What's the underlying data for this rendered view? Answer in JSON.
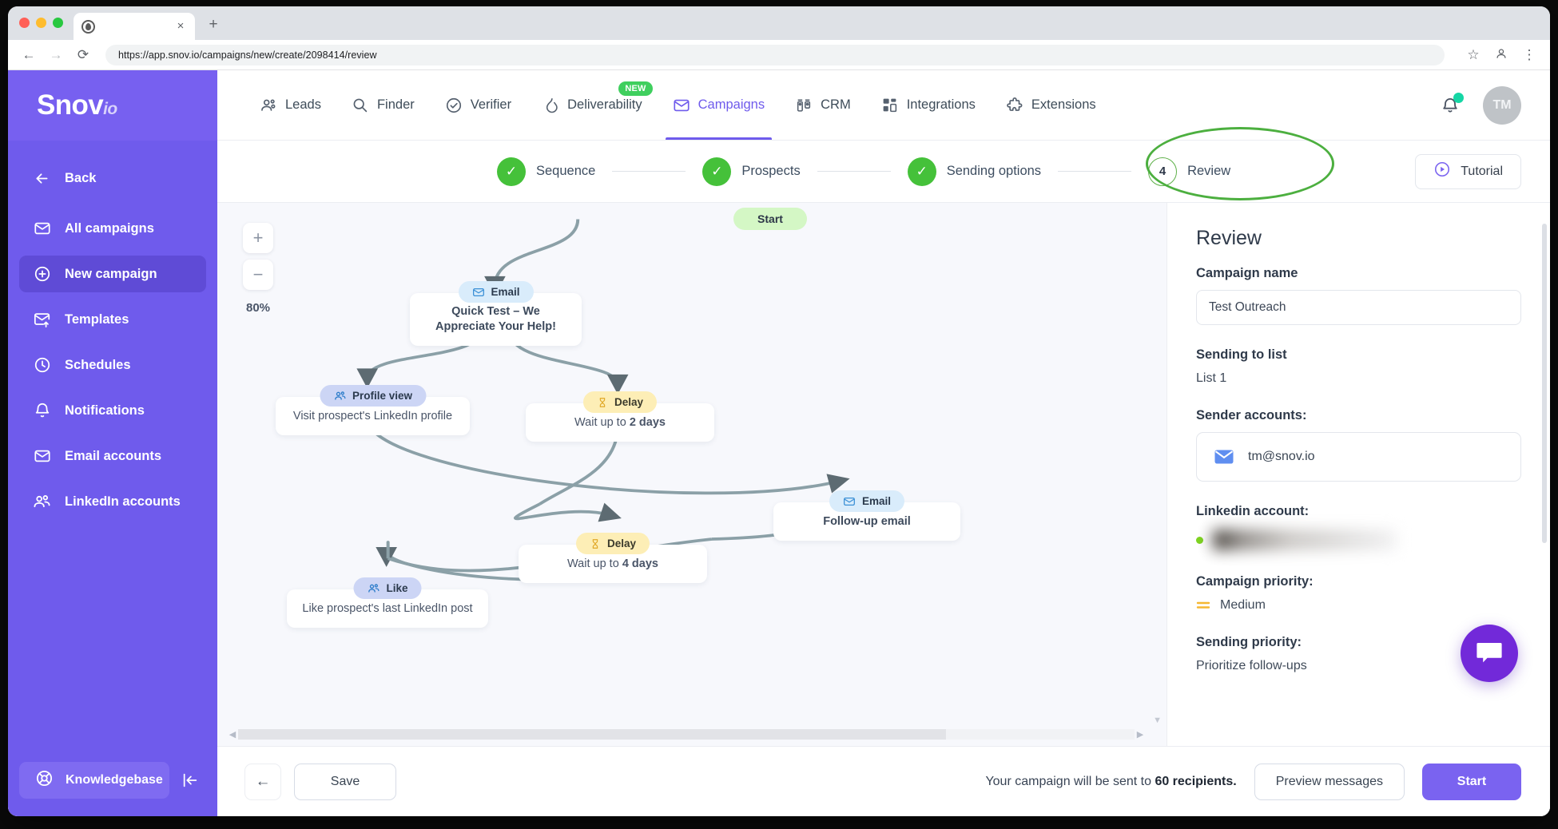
{
  "browser": {
    "url": "https://app.snov.io/campaigns/new/create/2098414/review",
    "tab_close_glyph": "×",
    "new_tab_glyph": "+",
    "back_glyph": "←",
    "forward_glyph": "→",
    "reload_glyph": "⟳",
    "star_glyph": "☆",
    "menu_glyph": "⋮"
  },
  "sidebar": {
    "logo": "Snov",
    "logo_suffix": "io",
    "back_label": "Back",
    "items": [
      {
        "label": "All campaigns",
        "icon": "envelope-icon",
        "active": false
      },
      {
        "label": "New campaign",
        "icon": "plus-circle-icon",
        "active": true
      },
      {
        "label": "Templates",
        "icon": "template-icon",
        "active": false
      },
      {
        "label": "Schedules",
        "icon": "clock-icon",
        "active": false
      },
      {
        "label": "Notifications",
        "icon": "bell-icon",
        "active": false
      },
      {
        "label": "Email accounts",
        "icon": "envelope-icon",
        "active": false
      },
      {
        "label": "LinkedIn accounts",
        "icon": "people-icon",
        "active": false
      }
    ],
    "knowledgebase_label": "Knowledgebase",
    "collapse_icon": "collapse-panel-icon"
  },
  "topnav": {
    "items": [
      {
        "label": "Leads",
        "icon": "people-icon",
        "active": false,
        "badge": ""
      },
      {
        "label": "Finder",
        "icon": "search-icon",
        "active": false,
        "badge": ""
      },
      {
        "label": "Verifier",
        "icon": "check-circle-icon",
        "active": false,
        "badge": ""
      },
      {
        "label": "Deliverability",
        "icon": "flame-icon",
        "active": false,
        "badge": "NEW"
      },
      {
        "label": "Campaigns",
        "icon": "envelope-icon",
        "active": true,
        "badge": ""
      },
      {
        "label": "CRM",
        "icon": "crm-icon",
        "active": false,
        "badge": ""
      },
      {
        "label": "Integrations",
        "icon": "grid-icon",
        "active": false,
        "badge": ""
      },
      {
        "label": "Extensions",
        "icon": "puzzle-icon",
        "active": false,
        "badge": ""
      }
    ],
    "avatar_initials": "TM"
  },
  "stepper": {
    "steps": [
      {
        "label": "Sequence",
        "state": "done",
        "mark": "✓"
      },
      {
        "label": "Prospects",
        "state": "done",
        "mark": "✓"
      },
      {
        "label": "Sending options",
        "state": "done",
        "mark": "✓"
      },
      {
        "label": "Review",
        "state": "current",
        "mark": "4"
      }
    ],
    "tutorial_label": "Tutorial"
  },
  "canvas": {
    "zoom_in": "+",
    "zoom_out": "−",
    "zoom_level": "80%",
    "nodes": [
      {
        "id": "start",
        "type": "start",
        "title": "Start"
      },
      {
        "id": "email1",
        "chip": "Email",
        "chip_type": "email",
        "title": "Quick Test – We Appreciate Your Help!"
      },
      {
        "id": "profileview",
        "chip": "Profile view",
        "chip_type": "linkedin",
        "title": "Visit prospect's LinkedIn profile"
      },
      {
        "id": "delay1",
        "chip": "Delay",
        "chip_type": "delay",
        "title": "Wait up to ",
        "title_bold": "2 days"
      },
      {
        "id": "email2",
        "chip": "Email",
        "chip_type": "email",
        "title": "Follow-up email"
      },
      {
        "id": "delay2",
        "chip": "Delay",
        "chip_type": "delay",
        "title": "Wait up to ",
        "title_bold": "4 days"
      },
      {
        "id": "like",
        "chip": "Like",
        "chip_type": "linkedin",
        "title": "Like prospect's last LinkedIn post"
      }
    ]
  },
  "review": {
    "title": "Review",
    "campaign_name_label": "Campaign name",
    "campaign_name_value": "Test Outreach",
    "sending_to_list_label": "Sending to list",
    "sending_to_list_value": "List 1",
    "sender_accounts_label": "Sender accounts:",
    "sender_email": "tm@snov.io",
    "linkedin_account_label": "Linkedin account:",
    "linkedin_account_value": "",
    "campaign_priority_label": "Campaign priority:",
    "campaign_priority_value": "Medium",
    "sending_priority_label": "Sending priority:",
    "sending_priority_value": "Prioritize follow-ups"
  },
  "bottombar": {
    "back_glyph": "←",
    "save_label": "Save",
    "recipients_prefix": "Your campaign will be sent to ",
    "recipients_count": "60 recipients.",
    "preview_label": "Preview messages",
    "start_label": "Start"
  },
  "colors": {
    "brand_purple": "#6f5bec",
    "accent_green": "#45c13a",
    "highlight_green": "#4caf3f",
    "chip_email": "#d9ecfb",
    "chip_delay": "#fdeeb6",
    "chip_linkedin": "#ccd5f5",
    "start_node": "#d4f7c5",
    "chat_purple": "#7229d9"
  }
}
